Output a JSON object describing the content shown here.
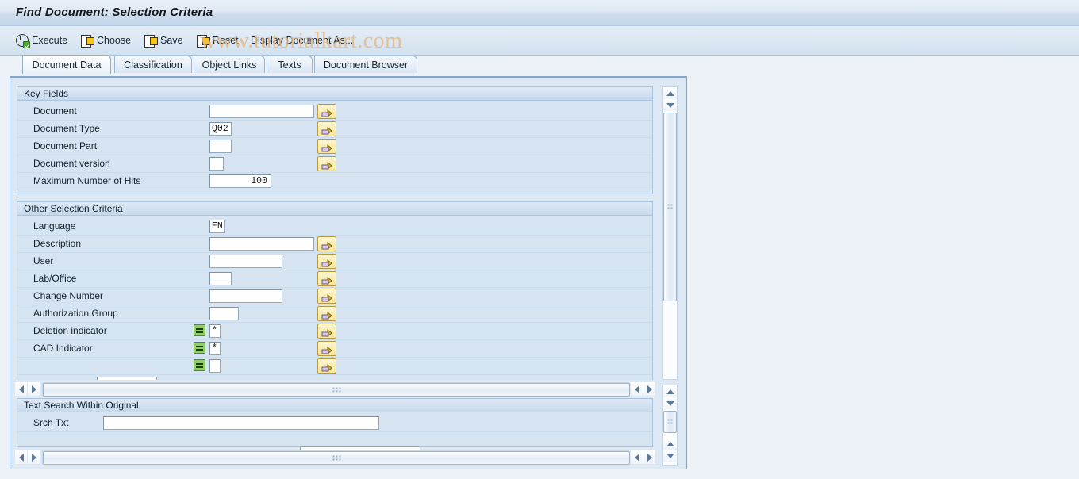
{
  "window": {
    "title": "Find Document: Selection Criteria"
  },
  "watermark": "www.tutorialkart.com",
  "toolbar": {
    "buttons": [
      {
        "label": "Execute",
        "icon": "execute-icon"
      },
      {
        "label": "Choose",
        "icon": "choose-icon"
      },
      {
        "label": "Save",
        "icon": "save-icon"
      },
      {
        "label": "Reset",
        "icon": "reset-icon"
      }
    ],
    "display_document_as": "Display Document As..."
  },
  "tabs": [
    {
      "label": "Document Data",
      "active": true
    },
    {
      "label": "Classification",
      "active": false
    },
    {
      "label": "Object Links",
      "active": false
    },
    {
      "label": "Texts",
      "active": false
    },
    {
      "label": "Document Browser",
      "active": false
    }
  ],
  "key_fields": {
    "header": "Key Fields",
    "rows": [
      {
        "label": "Document",
        "value": "",
        "field_width": 132,
        "multi": true
      },
      {
        "label": "Document Type",
        "value": "Q02",
        "field_width": 28,
        "multi": true
      },
      {
        "label": "Document Part",
        "value": "",
        "field_width": 28,
        "multi": true
      },
      {
        "label": "Document version",
        "value": "",
        "field_width": 18,
        "multi": true
      },
      {
        "label": "Maximum Number of Hits",
        "value": "100",
        "field_width": 78,
        "multi": false,
        "numeric": true
      }
    ]
  },
  "other_criteria": {
    "header": "Other Selection Criteria",
    "rows": [
      {
        "label": "Language",
        "value": "EN",
        "field_width": 19,
        "multi": false
      },
      {
        "label": "Description",
        "value": "",
        "field_width": 132,
        "multi": true
      },
      {
        "label": "User",
        "value": "",
        "field_width": 92,
        "multi": true
      },
      {
        "label": "Lab/Office",
        "value": "",
        "field_width": 28,
        "multi": true
      },
      {
        "label": "Change Number",
        "value": "",
        "field_width": 92,
        "multi": true
      },
      {
        "label": "Authorization Group",
        "value": "",
        "field_width": 37,
        "multi": true
      },
      {
        "label": "Deletion indicator",
        "value": "*",
        "field_width": 14,
        "multi": true,
        "operator_icon": "equals-icon"
      },
      {
        "label": "CAD Indicator",
        "value": "*",
        "field_width": 14,
        "multi": true,
        "operator_icon": "equals-icon"
      },
      {
        "label": "",
        "value": "",
        "field_width": 14,
        "multi": true,
        "operator_icon": "equals-icon",
        "partial": true
      }
    ]
  },
  "text_search": {
    "header": "Text Search Within Original",
    "search_label": "Srch Txt",
    "search_value": "",
    "search_placeholder": ""
  },
  "scrollbars": {
    "up_arrow": "scroll-up-arrow",
    "down_arrow": "scroll-down-arrow",
    "left_arrow": "scroll-left-arrow",
    "right_arrow": "scroll-right-arrow"
  },
  "colors": {
    "title_bar": "#c3d6ea",
    "panel_bg": "#d9e5f1",
    "group_bg": "#d6e4f2",
    "accent_button": "#f6e79a",
    "operator_green": "#8fce6a",
    "page_bg": "#ebf1f7"
  }
}
